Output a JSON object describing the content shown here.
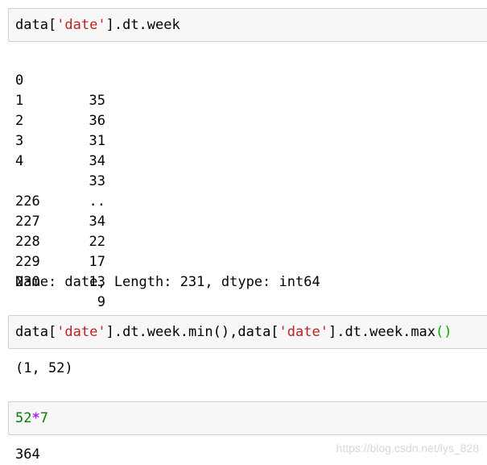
{
  "cell1": {
    "code": {
      "p1": "data[",
      "s1": "'date'",
      "p2": "].dt.week"
    },
    "output": {
      "rows": [
        {
          "index": "0",
          "value": "35"
        },
        {
          "index": "1",
          "value": "36"
        },
        {
          "index": "2",
          "value": "31"
        },
        {
          "index": "3",
          "value": "34"
        },
        {
          "index": "4",
          "value": "33"
        },
        {
          "index": "",
          "value": ".."
        },
        {
          "index": "226",
          "value": "34"
        },
        {
          "index": "227",
          "value": "22"
        },
        {
          "index": "228",
          "value": "17"
        },
        {
          "index": "229",
          "value": "13"
        },
        {
          "index": "230",
          "value": "9"
        }
      ],
      "footer": "Name: date, Length: 231, dtype: int64"
    }
  },
  "cell2": {
    "code": {
      "p1": "data[",
      "s1": "'date'",
      "p2": "].dt.week.min(),data[",
      "s2": "'date'",
      "p3": "].dt.week.max",
      "paren": "()"
    },
    "output": "(1, 52)"
  },
  "cell3": {
    "code": {
      "n1": "52",
      "op": "*",
      "n2": "7"
    },
    "output": "364"
  },
  "watermark": "https://blog.csdn.net/lys_828"
}
